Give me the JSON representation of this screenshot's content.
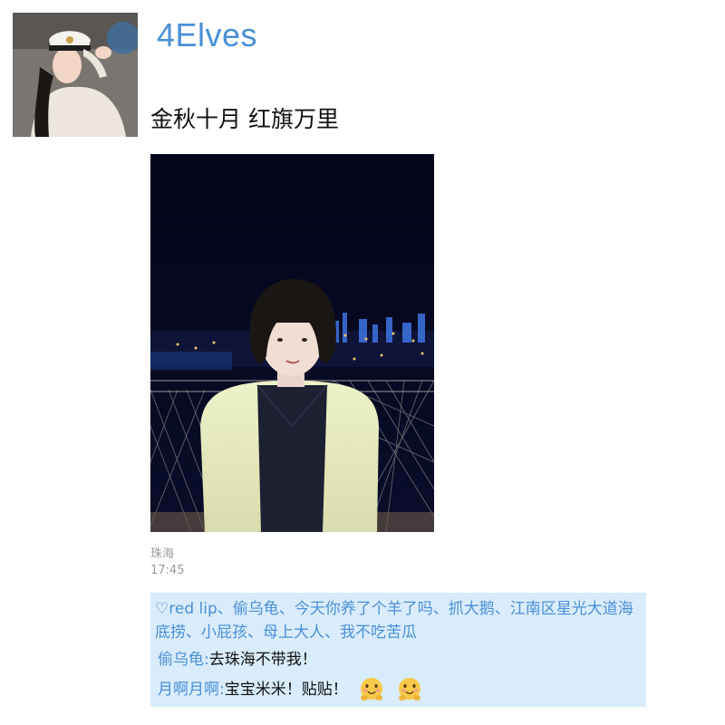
{
  "post": {
    "username": "4Elves",
    "text": "金秋十月 红旗万里",
    "location": "珠海",
    "time": "17:45"
  },
  "likes": {
    "icon": "heart-outline-icon",
    "text": "red lip、偷乌龟、今天你养了个羊了吗、抓大鹅、江南区星光大道海底捞、小屁孩、母上大人、我不吃苦瓜"
  },
  "comments": [
    {
      "author": "偷乌龟",
      "separator": ":",
      "text": "去珠海不带我！"
    },
    {
      "author": "月啊月啊",
      "separator": ":",
      "text": "宝宝米米！贴贴！",
      "emojis": [
        "hug-emoji",
        "hug-emoji"
      ]
    }
  ],
  "colors": {
    "accent": "#4a8fd6",
    "comment_bg": "#d9ecfb",
    "meta_text": "#9a9a9a"
  }
}
